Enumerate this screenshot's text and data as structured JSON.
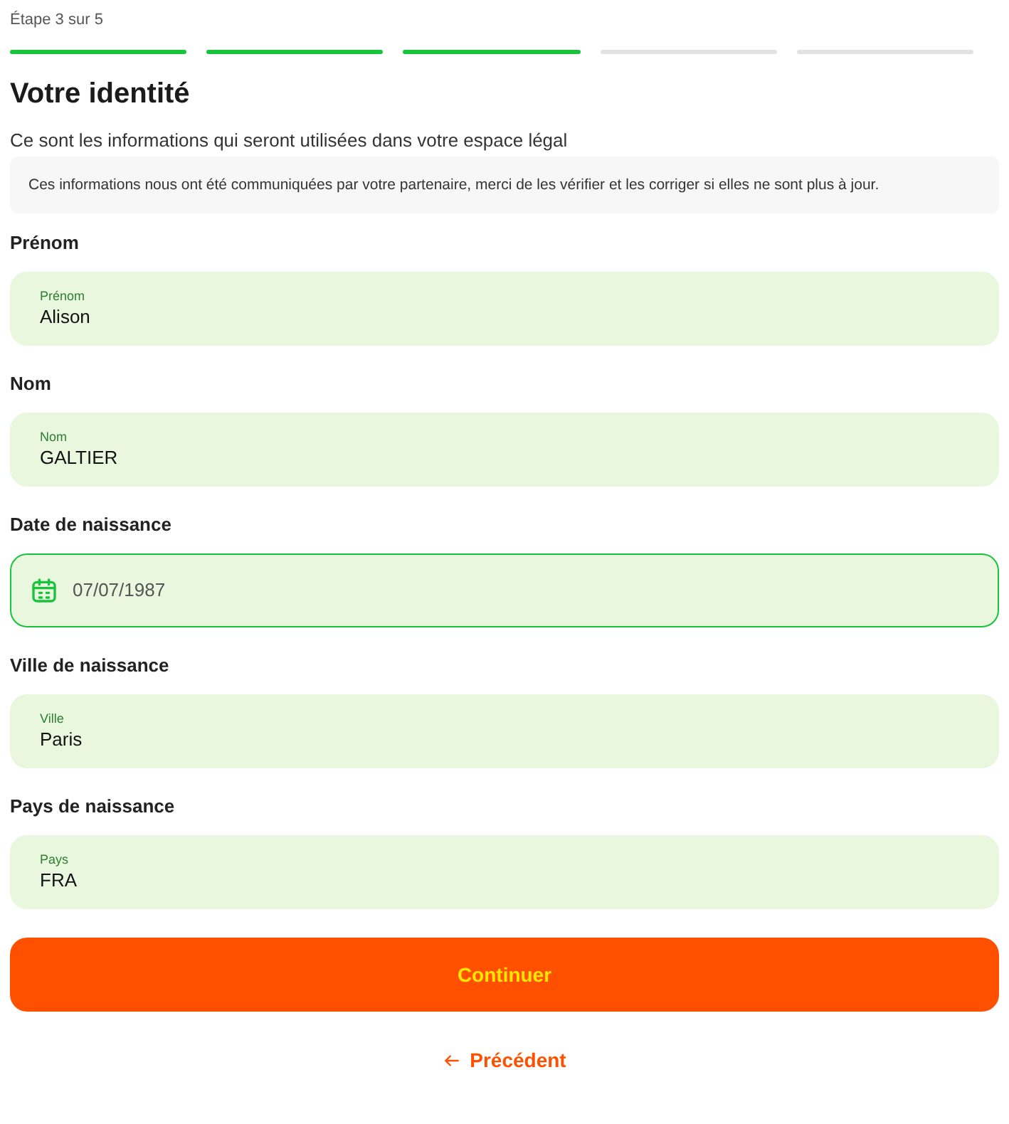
{
  "step_label": "Étape 3 sur 5",
  "steps": [
    {
      "done": true
    },
    {
      "done": true
    },
    {
      "done": true
    },
    {
      "done": false
    },
    {
      "done": false
    }
  ],
  "title": "Votre identité",
  "subtitle": "Ce sont les informations qui seront utilisées dans votre espace légal",
  "notice": "Ces informations nous ont été communiquées par votre partenaire, merci de les vérifier et les corriger si elles ne sont plus à jour.",
  "fields": [
    {
      "kind": "text",
      "label": "Prénom",
      "floating_label": "Prénom",
      "value": "Alison",
      "focused": false
    },
    {
      "kind": "text",
      "label": "Nom",
      "floating_label": "Nom",
      "value": "GALTIER",
      "focused": false
    },
    {
      "kind": "date",
      "label": "Date de naissance",
      "value": "07/07/1987",
      "focused": true
    },
    {
      "kind": "text",
      "label": "Ville de naissance",
      "floating_label": "Ville",
      "value": "Paris",
      "focused": false
    },
    {
      "kind": "text",
      "label": "Pays de naissance",
      "floating_label": "Pays",
      "value": "FRA",
      "focused": false
    }
  ],
  "continue_button": "Continuer",
  "back_link": "Précédent"
}
